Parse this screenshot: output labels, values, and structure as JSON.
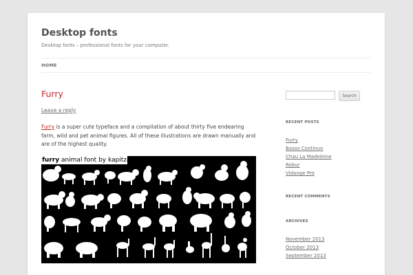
{
  "site": {
    "title": "Desktop fonts",
    "description": "Desktop fonts – professional fonts for your computer."
  },
  "nav": {
    "home_label": "HOME"
  },
  "post": {
    "title": "Furry",
    "reply_label": "Leave a reply",
    "body_link": "Furry",
    "body_text": " is a super cute typeface and a compilation of about thirty five endearing farm, wild and pet animal figures. All of these illustrations are drawn manually and are of the highest quality.",
    "image_caption_bold": "furry",
    "image_caption_rest": " animal font by kapitza"
  },
  "sidebar": {
    "search_placeholder": "",
    "search_button": "Search",
    "recent_posts_title": "RECENT POSTS",
    "recent_posts": [
      "Furry",
      "Basso Continuo",
      "Chau La Madeleine",
      "Robur",
      "Vidange Pro"
    ],
    "recent_comments_title": "RECENT COMMENTS",
    "archives_title": "ARCHIVES",
    "archives": [
      "November 2013",
      "October 2013",
      "September 2013"
    ]
  },
  "colors": {
    "accent": "#c6232d",
    "background": "#e6e6e6",
    "page": "#ffffff",
    "banner": "#000000"
  }
}
